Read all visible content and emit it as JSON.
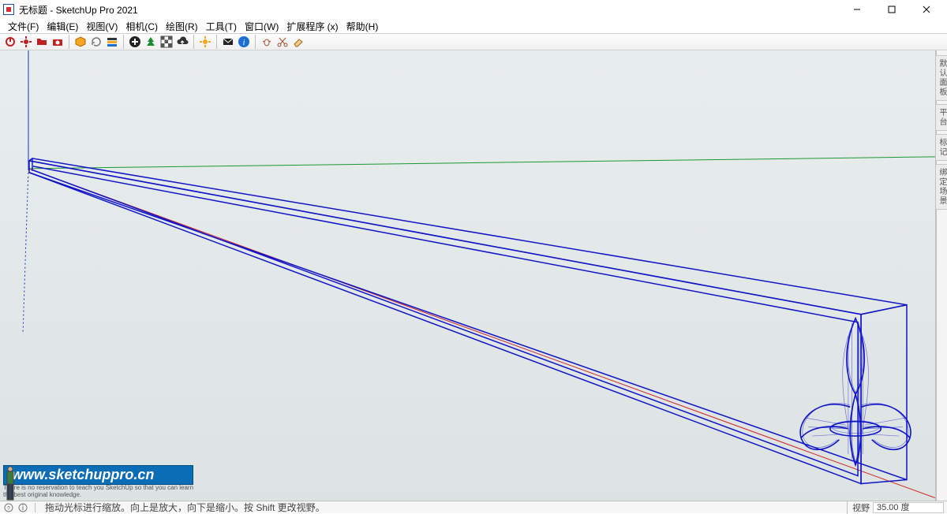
{
  "title": "无标题 - SketchUp Pro 2021",
  "menus": [
    "文件(F)",
    "编辑(E)",
    "视图(V)",
    "相机(C)",
    "绘图(R)",
    "工具(T)",
    "窗口(W)",
    "扩展程序 (x)",
    "帮助(H)"
  ],
  "trays": [
    "默认面板",
    "平台",
    "标记",
    "绑定场景"
  ],
  "watermark": {
    "url": "www.sketchuppro.cn",
    "tag1": "There is no reservation to teach you SketchUp so that you can learn",
    "tag2": "the best original knowledge."
  },
  "status": {
    "hint": "拖动光标进行缩放。向上是放大，向下是缩小。按 Shift 更改视野。",
    "field_label": "视野",
    "field_value": "35.00 度"
  }
}
